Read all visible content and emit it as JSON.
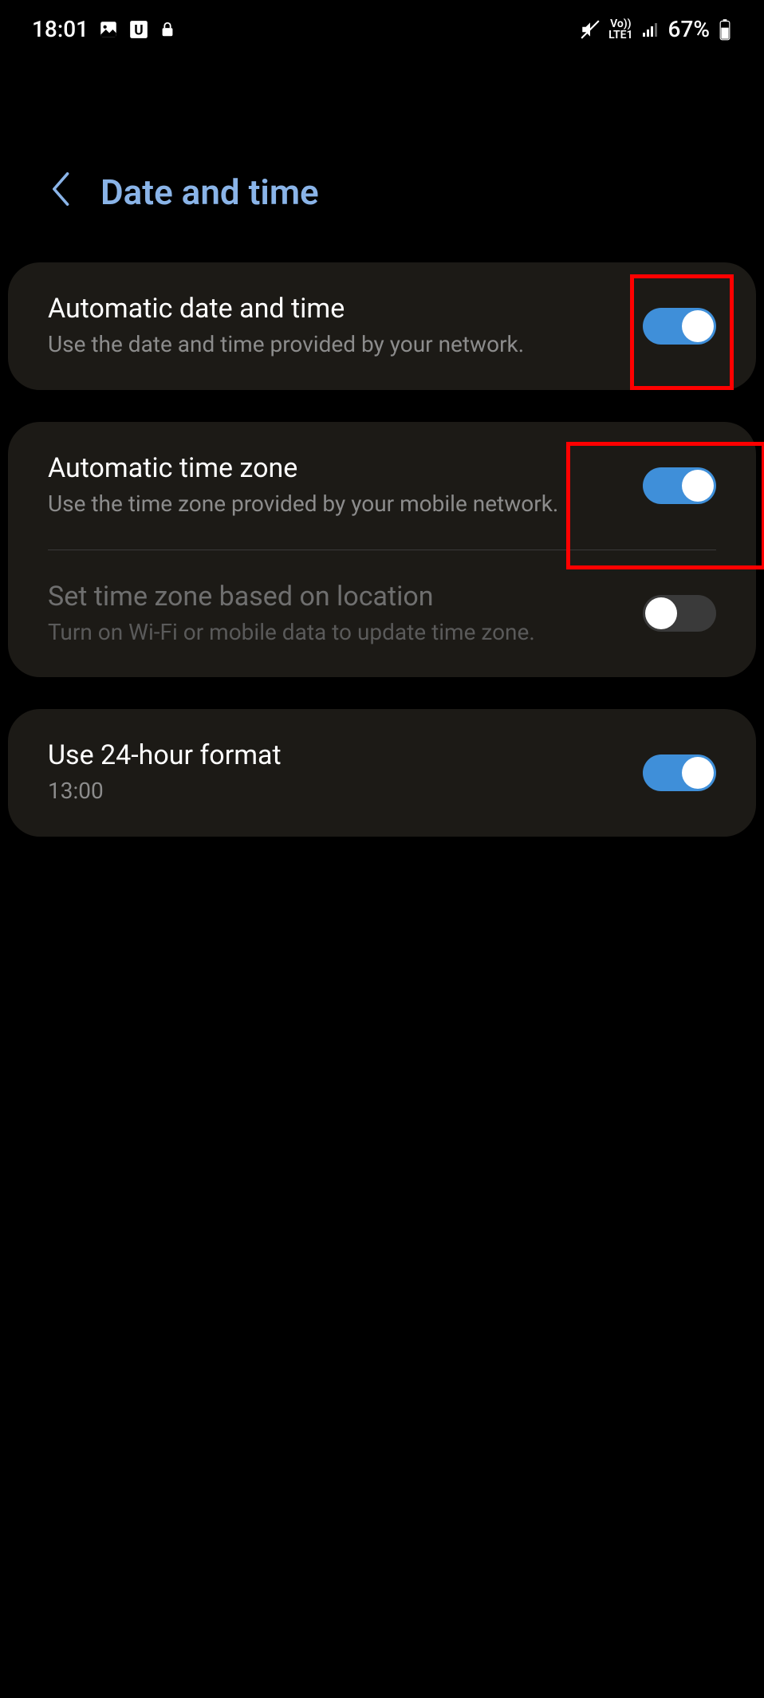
{
  "status_bar": {
    "time": "18:01",
    "battery_percent": "67%"
  },
  "header": {
    "title": "Date and time"
  },
  "rows": {
    "auto_datetime": {
      "title": "Automatic date and time",
      "sub": "Use the date and time provided by your network."
    },
    "auto_tz": {
      "title": "Automatic time zone",
      "sub": "Use the time zone provided by your mobile network."
    },
    "loc_tz": {
      "title": "Set time zone based on location",
      "sub": "Turn on Wi-Fi or mobile data to update time zone."
    },
    "hour24": {
      "title": "Use 24-hour format",
      "sub": "13:00"
    }
  },
  "toggles": {
    "auto_datetime": true,
    "auto_tz": true,
    "loc_tz": false,
    "hour24": true
  }
}
